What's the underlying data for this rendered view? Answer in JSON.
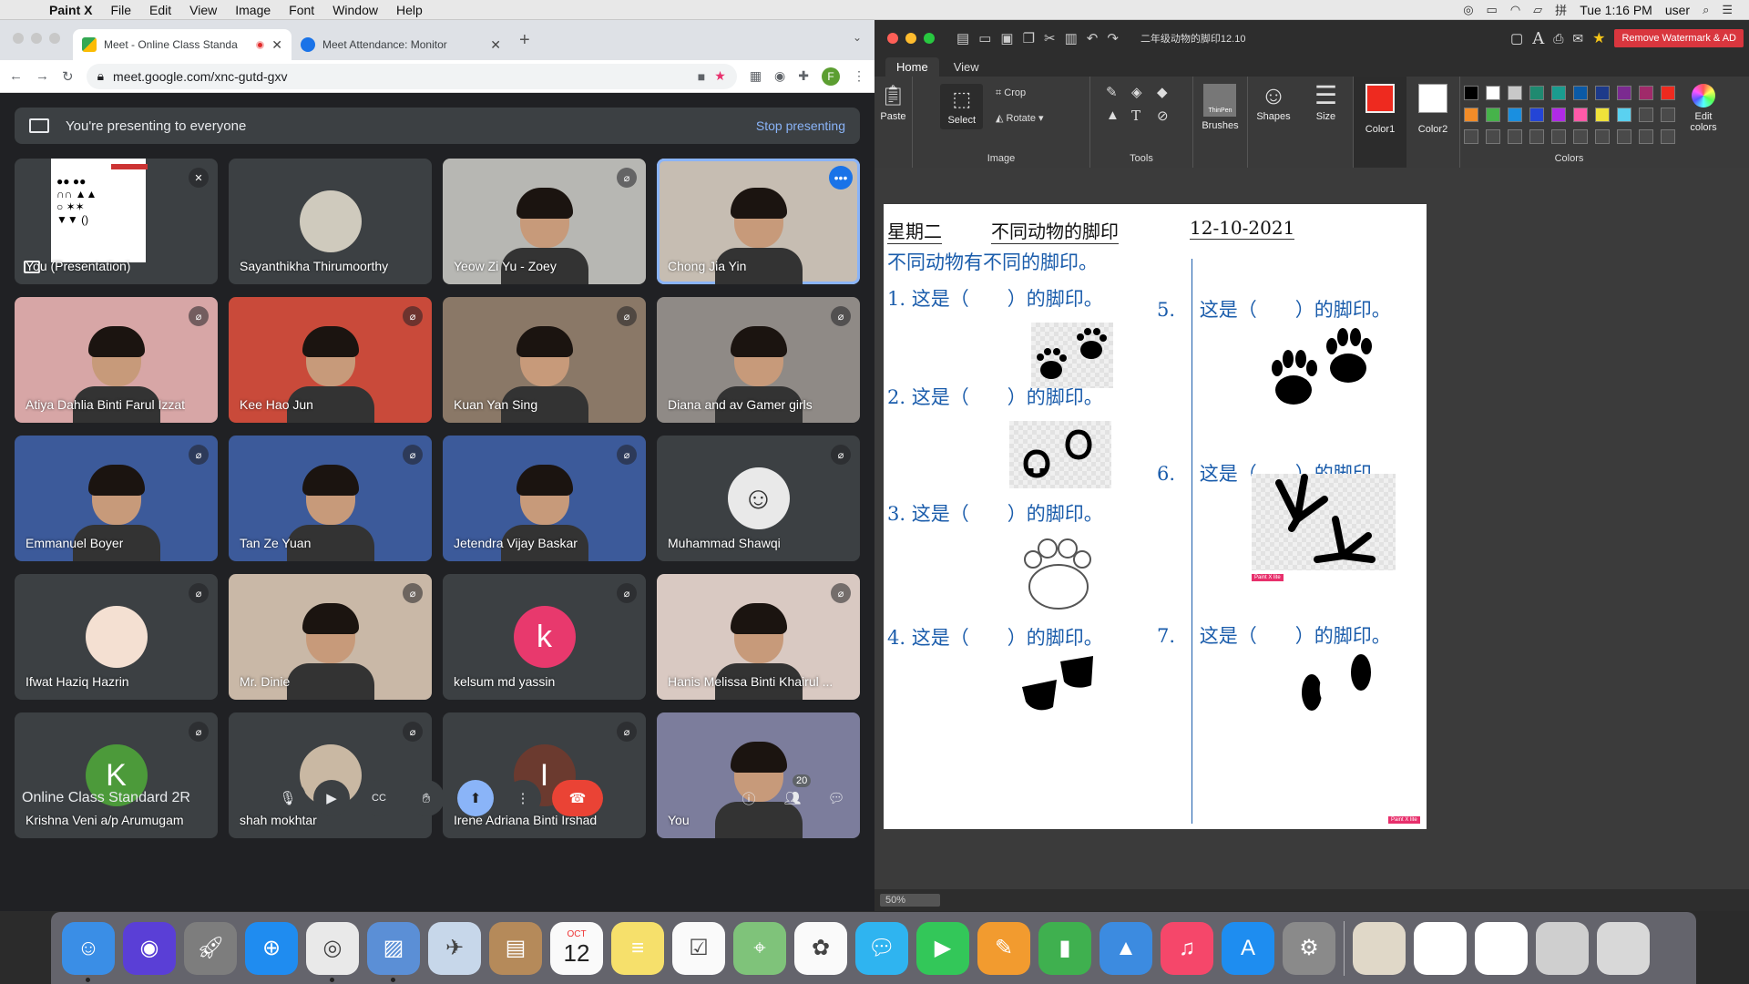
{
  "menubar": {
    "app_name": "Paint X",
    "menus": [
      "File",
      "Edit",
      "View",
      "Image",
      "Font",
      "Window",
      "Help"
    ],
    "clock": "Tue 1:16 PM",
    "user": "user"
  },
  "browser": {
    "tabs": [
      {
        "title": "Meet - Online Class Standa",
        "recording": true
      },
      {
        "title": "Meet Attendance: Monitor"
      }
    ],
    "url": "meet.google.com/xnc-gutd-gxv",
    "profile_initial": "F"
  },
  "meet": {
    "banner_text": "You're presenting to everyone",
    "stop_presenting": "Stop presenting",
    "meeting_name": "Online Class Standard 2R",
    "participants_count": "20",
    "tiles": [
      {
        "name": "You (Presentation)",
        "kind": "presentation"
      },
      {
        "name": "Sayanthikha Thirumoorthy",
        "kind": "avatar-photo",
        "color": "#cfcabd"
      },
      {
        "name": "Yeow Zi Yu - Zoey",
        "kind": "video",
        "bg": "#b7b7b3",
        "muted": true
      },
      {
        "name": "Chong Jia Yin",
        "kind": "video",
        "bg": "#c6bdb2",
        "active": true
      },
      {
        "name": "Atiya Dahlia Binti Farul Izzat",
        "kind": "video",
        "bg": "#d7a6a6",
        "muted": true
      },
      {
        "name": "Kee Hao Jun",
        "kind": "video",
        "bg": "#c94a3a",
        "muted": true
      },
      {
        "name": "Kuan Yan Sing",
        "kind": "video",
        "bg": "#8a7867",
        "muted": true
      },
      {
        "name": "Diana and av Gamer girls",
        "kind": "video",
        "bg": "#8f8a86",
        "muted": true
      },
      {
        "name": "Emmanuel Boyer",
        "kind": "video",
        "bg": "#3c5a9a",
        "muted": true
      },
      {
        "name": "Tan Ze Yuan",
        "kind": "video",
        "bg": "#3c5a9a",
        "muted": true
      },
      {
        "name": "Jetendra Vijay Baskar",
        "kind": "video",
        "bg": "#3c5a9a",
        "muted": true
      },
      {
        "name": "Muhammad Shawqi",
        "kind": "avatar",
        "color": "#e9e9e9",
        "letter": "☺",
        "muted": true
      },
      {
        "name": "Ifwat Haziq Hazrin",
        "kind": "avatar",
        "color": "#f4e0d2",
        "letter": "",
        "muted": true
      },
      {
        "name": "Mr. Dinie",
        "kind": "video",
        "bg": "#c9b8a7",
        "muted": true
      },
      {
        "name": "kelsum md yassin",
        "kind": "avatar",
        "color": "#e8396d",
        "letter": "k",
        "muted": true
      },
      {
        "name": "Hanis Melissa Binti Khairul ...",
        "kind": "video",
        "bg": "#d9c9c2",
        "muted": true
      },
      {
        "name": "Krishna Veni a/p Arumugam",
        "kind": "avatar",
        "color": "#4c9a3a",
        "letter": "K",
        "muted": true
      },
      {
        "name": "shah mokhtar",
        "kind": "avatar",
        "color": "#c9b8a3",
        "letter": "",
        "muted": true
      },
      {
        "name": "Irene Adriana Binti Irshad",
        "kind": "avatar",
        "color": "#6b3a2f",
        "letter": "I",
        "muted": true
      },
      {
        "name": "You",
        "kind": "video",
        "bg": "#7c7d9c"
      }
    ]
  },
  "paint": {
    "document_title": "二年级动物的脚印12.10",
    "remove_watermark": "Remove Watermark & AD",
    "tabs": [
      "Home",
      "View"
    ],
    "ribbon": {
      "paste": "Paste",
      "select": "Select",
      "crop": "Crop",
      "rotate": "Rotate",
      "image_group": "Image",
      "tools_group": "Tools",
      "brushes": "Brushes",
      "brush_name": "ThinPen",
      "shapes": "Shapes",
      "size": "Size",
      "color1": "Color1",
      "color2": "Color2",
      "colors_group": "Colors",
      "edit_colors": "Edit colors",
      "color1_value": "#ee2a1f",
      "color2_value": "#ffffff"
    },
    "palette": [
      "#000000",
      "#ffffff",
      "#c8c8c8",
      "#1f8a70",
      "#1a9c8f",
      "#0b5aa6",
      "#1d3a8a",
      "#7b2a90",
      "#a02a6a",
      "#ee2a1f",
      "#f28c28",
      "#46b34a",
      "#1a8fe0",
      "#2445d6",
      "#b02ae6",
      "#ff5aa8",
      "#f0e23a",
      "#5ad1f0"
    ],
    "zoom": "50%",
    "sheet": {
      "day": "星期二",
      "title": "不同动物的脚印",
      "date": "12-10-2021",
      "subtitle": "不同动物有不同的脚印。",
      "questions": [
        {
          "num": "1.",
          "text": "这是（　　）的脚印。"
        },
        {
          "num": "2.",
          "text": "这是（　　）的脚印。"
        },
        {
          "num": "3.",
          "text": "这是（　　）的脚印。"
        },
        {
          "num": "4.",
          "text": "这是（　　）的脚印。"
        },
        {
          "num": "5.",
          "text": "这是（　　）的脚印。"
        },
        {
          "num": "6.",
          "text": "这是（　　）的脚印。"
        },
        {
          "num": "7.",
          "text": "这是（　　）的脚印。"
        }
      ],
      "watermark": "Paint X lite"
    }
  },
  "dock": {
    "apps": [
      "Finder",
      "Siri",
      "Launchpad",
      "Safari",
      "Chrome",
      "Preview",
      "Mail",
      "Contacts",
      "Calendar",
      "Notes",
      "Reminders",
      "Maps",
      "Photos",
      "Messages",
      "FaceTime",
      "Pages",
      "Numbers",
      "Keynote",
      "Music",
      "App Store",
      "System Preferences"
    ],
    "calendar_month": "OCT",
    "calendar_day": "12"
  }
}
